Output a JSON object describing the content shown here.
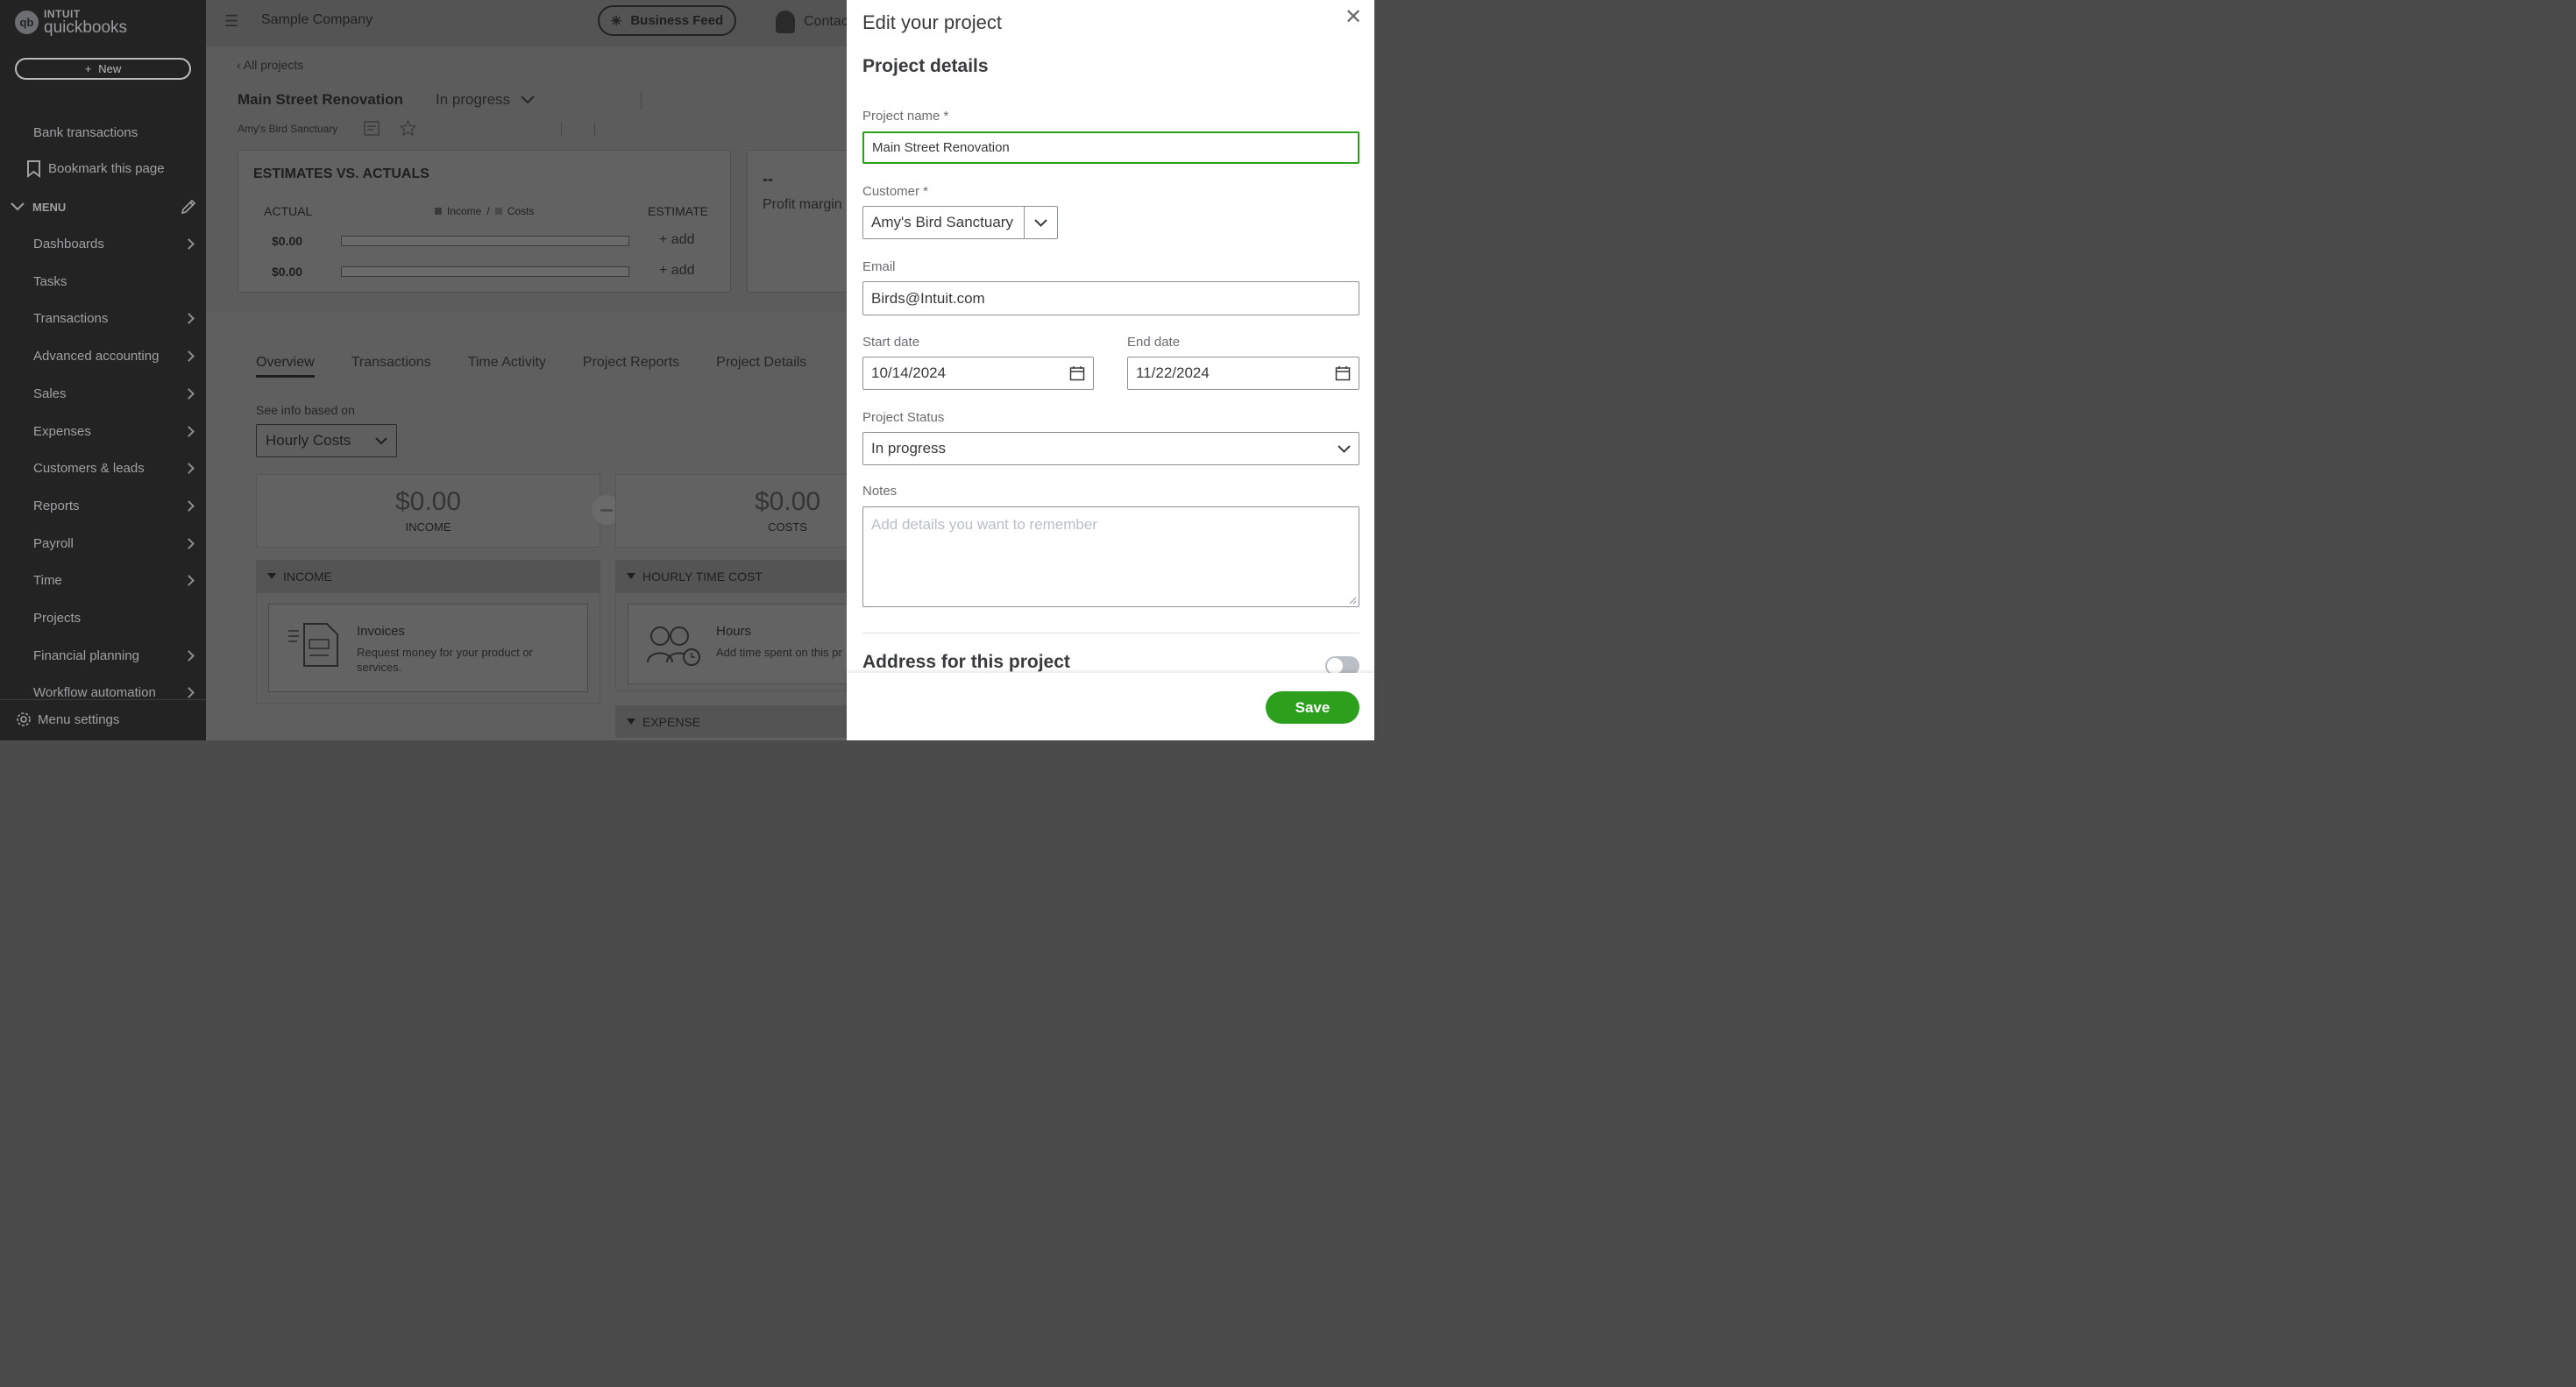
{
  "sidebar": {
    "logo_intuit": "INTUIT",
    "logo_product": "quickbooks",
    "logo_mark": "qb",
    "new_button": "New",
    "bank_transactions": "Bank transactions",
    "bookmark": "Bookmark this page",
    "menu_label": "MENU",
    "items": [
      {
        "label": "Dashboards",
        "chevron": true
      },
      {
        "label": "Tasks",
        "chevron": false
      },
      {
        "label": "Transactions",
        "chevron": true
      },
      {
        "label": "Advanced accounting",
        "chevron": true
      },
      {
        "label": "Sales",
        "chevron": true
      },
      {
        "label": "Expenses",
        "chevron": true
      },
      {
        "label": "Customers & leads",
        "chevron": true
      },
      {
        "label": "Reports",
        "chevron": true
      },
      {
        "label": "Payroll",
        "chevron": true
      },
      {
        "label": "Time",
        "chevron": true
      },
      {
        "label": "Projects",
        "chevron": false
      },
      {
        "label": "Financial planning",
        "chevron": true
      },
      {
        "label": "Workflow automation",
        "chevron": true
      }
    ],
    "menu_settings": "Menu settings"
  },
  "header": {
    "company": "Sample Company",
    "business_feed": "Business Feed",
    "contact": "Contac"
  },
  "project": {
    "back_link": "All projects",
    "title": "Main Street Renovation",
    "status": "In progress",
    "customer": "Amy's Bird Sanctuary"
  },
  "estimates": {
    "title": "ESTIMATES VS. ACTUALS",
    "actual_label": "ACTUAL",
    "estimate_label": "ESTIMATE",
    "legend_income": "Income",
    "legend_sep": "/",
    "legend_costs": "Costs",
    "rows": [
      {
        "actual": "$0.00",
        "add": "+ add"
      },
      {
        "actual": "$0.00",
        "add": "+ add"
      }
    ]
  },
  "profit": {
    "value": "--",
    "label": "Profit margin"
  },
  "tabs": [
    "Overview",
    "Transactions",
    "Time Activity",
    "Project Reports",
    "Project Details"
  ],
  "overview": {
    "see_info": "See info based on",
    "basis": "Hourly Costs",
    "income_amount": "$0.00",
    "income_label": "INCOME",
    "costs_amount": "$0.00",
    "costs_label": "COSTS",
    "income_section": "INCOME",
    "hourly_section": "HOURLY TIME COST",
    "expense_section": "EXPENSE",
    "invoices_title": "Invoices",
    "invoices_desc": "Request money for your product or services.",
    "hours_title": "Hours",
    "hours_desc": "Add time spent on this pr"
  },
  "drawer": {
    "title": "Edit your project",
    "section_title": "Project details",
    "project_name_label": "Project name *",
    "project_name_value": "Main Street Renovation",
    "customer_label": "Customer *",
    "customer_value": "Amy's Bird Sanctuary",
    "email_label": "Email",
    "email_value": "Birds@Intuit.com",
    "start_label": "Start date",
    "start_value": "10/14/2024",
    "end_label": "End date",
    "end_value": "11/22/2024",
    "status_label": "Project Status",
    "status_value": "In progress",
    "notes_label": "Notes",
    "notes_placeholder": "Add details you want to remember",
    "address_title": "Address for this project",
    "address_toggle_on": false,
    "save_label": "Save"
  },
  "colors": {
    "accent_green": "#2ca01c",
    "sidebar_bg": "#232323",
    "overlay": "#5c5c5d"
  }
}
